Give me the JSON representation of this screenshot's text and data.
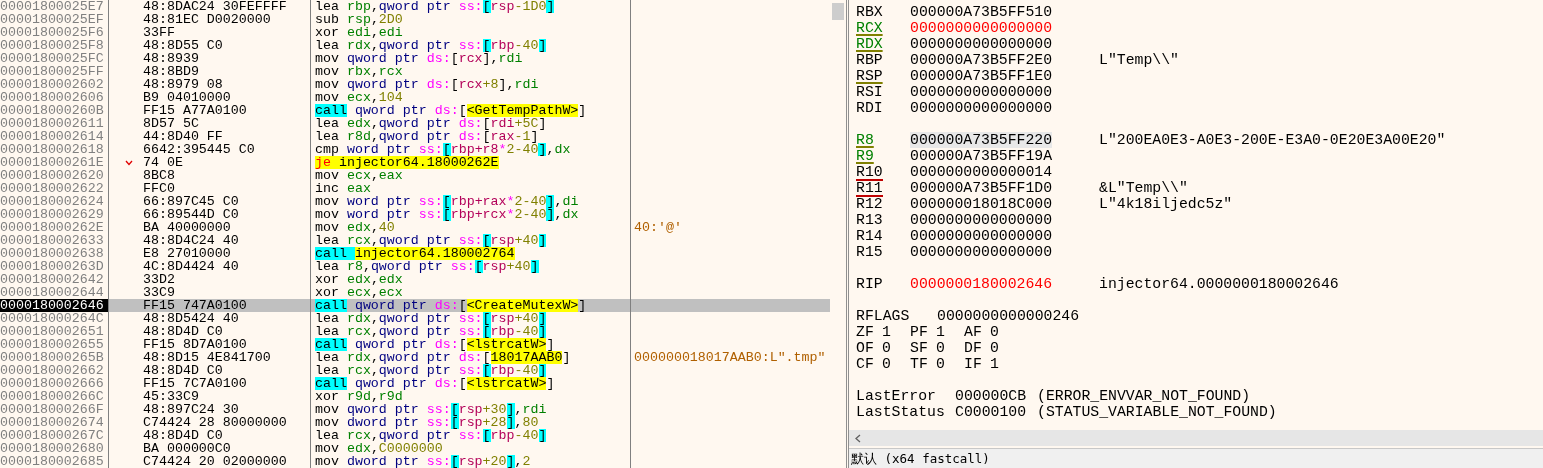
{
  "disassembly": {
    "rows": [
      {
        "address": "00001800025E7",
        "bytes": "48:8DAC24 30FEFFFF",
        "jump_arrow": false,
        "current": false,
        "tokens": [
          {
            "text": "lea ",
            "kind": "mnemonic"
          },
          {
            "text": "rbp",
            "kind": "register"
          },
          {
            "text": ",",
            "kind": "plain"
          },
          {
            "text": "qword ptr ",
            "kind": "size"
          },
          {
            "text": "ss:",
            "kind": "segment"
          },
          {
            "text": "[",
            "kind": "bracket"
          },
          {
            "text": "rsp",
            "kind": "memreg"
          },
          {
            "text": "-1D0",
            "kind": "number"
          },
          {
            "text": "]",
            "kind": "bracket"
          }
        ]
      },
      {
        "address": "00001800025EF",
        "bytes": "48:81EC D0020000",
        "jump_arrow": false,
        "current": false,
        "tokens": [
          {
            "text": "sub ",
            "kind": "mnemonic"
          },
          {
            "text": "rsp",
            "kind": "register"
          },
          {
            "text": ",",
            "kind": "plain"
          },
          {
            "text": "2D0",
            "kind": "number"
          }
        ]
      },
      {
        "address": "00001800025F6",
        "bytes": "33FF",
        "jump_arrow": false,
        "current": false,
        "tokens": [
          {
            "text": "xor ",
            "kind": "mnemonic"
          },
          {
            "text": "edi",
            "kind": "register"
          },
          {
            "text": ",",
            "kind": "plain"
          },
          {
            "text": "edi",
            "kind": "register"
          }
        ]
      },
      {
        "address": "00001800025F8",
        "bytes": "48:8D55 C0",
        "jump_arrow": false,
        "current": false,
        "tokens": [
          {
            "text": "lea ",
            "kind": "mnemonic"
          },
          {
            "text": "rdx",
            "kind": "register"
          },
          {
            "text": ",",
            "kind": "plain"
          },
          {
            "text": "qword ptr ",
            "kind": "size"
          },
          {
            "text": "ss:",
            "kind": "segment"
          },
          {
            "text": "[",
            "kind": "bracket"
          },
          {
            "text": "rbp",
            "kind": "memreg"
          },
          {
            "text": "-40",
            "kind": "number"
          },
          {
            "text": "]",
            "kind": "bracket"
          }
        ]
      },
      {
        "address": "00001800025FC",
        "bytes": "48:8939",
        "jump_arrow": false,
        "current": false,
        "tokens": [
          {
            "text": "mov ",
            "kind": "mnemonic"
          },
          {
            "text": "qword ptr ",
            "kind": "size"
          },
          {
            "text": "ds:",
            "kind": "segment"
          },
          {
            "text": "[",
            "kind": "plain"
          },
          {
            "text": "rcx",
            "kind": "memreg"
          },
          {
            "text": "],",
            "kind": "plain"
          },
          {
            "text": "rdi",
            "kind": "register"
          }
        ]
      },
      {
        "address": "00001800025FF",
        "bytes": "48:8BD9",
        "jump_arrow": false,
        "current": false,
        "tokens": [
          {
            "text": "mov ",
            "kind": "mnemonic"
          },
          {
            "text": "rbx",
            "kind": "register"
          },
          {
            "text": ",",
            "kind": "plain"
          },
          {
            "text": "rcx",
            "kind": "register"
          }
        ]
      },
      {
        "address": "0000180002602",
        "bytes": "48:8979 08",
        "jump_arrow": false,
        "current": false,
        "tokens": [
          {
            "text": "mov ",
            "kind": "mnemonic"
          },
          {
            "text": "qword ptr ",
            "kind": "size"
          },
          {
            "text": "ds:",
            "kind": "segment"
          },
          {
            "text": "[",
            "kind": "plain"
          },
          {
            "text": "rcx",
            "kind": "memreg"
          },
          {
            "text": "+8",
            "kind": "number"
          },
          {
            "text": "],",
            "kind": "plain"
          },
          {
            "text": "rdi",
            "kind": "register"
          }
        ]
      },
      {
        "address": "0000180002606",
        "bytes": "B9 04010000",
        "jump_arrow": false,
        "current": false,
        "tokens": [
          {
            "text": "mov ",
            "kind": "mnemonic"
          },
          {
            "text": "ecx",
            "kind": "register"
          },
          {
            "text": ",",
            "kind": "plain"
          },
          {
            "text": "104",
            "kind": "number"
          }
        ]
      },
      {
        "address": "000018000260B",
        "bytes": "FF15 A77A0100",
        "jump_arrow": false,
        "current": false,
        "tokens": [
          {
            "text": "call",
            "kind": "call"
          },
          {
            "text": " qword ptr ",
            "kind": "size"
          },
          {
            "text": "ds:",
            "kind": "segment"
          },
          {
            "text": "[",
            "kind": "plain"
          },
          {
            "text": "<GetTempPathW>",
            "kind": "label"
          },
          {
            "text": "]",
            "kind": "plain"
          }
        ]
      },
      {
        "address": "0000180002611",
        "bytes": "8D57 5C",
        "jump_arrow": false,
        "current": false,
        "tokens": [
          {
            "text": "lea ",
            "kind": "mnemonic"
          },
          {
            "text": "edx",
            "kind": "register"
          },
          {
            "text": ",",
            "kind": "plain"
          },
          {
            "text": "qword ptr ",
            "kind": "size"
          },
          {
            "text": "ds:",
            "kind": "segment"
          },
          {
            "text": "[",
            "kind": "plain"
          },
          {
            "text": "rdi",
            "kind": "memreg"
          },
          {
            "text": "+5C",
            "kind": "number"
          },
          {
            "text": "]",
            "kind": "plain"
          }
        ]
      },
      {
        "address": "0000180002614",
        "bytes": "44:8D40 FF",
        "jump_arrow": false,
        "current": false,
        "tokens": [
          {
            "text": "lea ",
            "kind": "mnemonic"
          },
          {
            "text": "r8d",
            "kind": "register"
          },
          {
            "text": ",",
            "kind": "plain"
          },
          {
            "text": "qword ptr ",
            "kind": "size"
          },
          {
            "text": "ds:",
            "kind": "segment"
          },
          {
            "text": "[",
            "kind": "plain"
          },
          {
            "text": "rax",
            "kind": "memreg"
          },
          {
            "text": "-1",
            "kind": "number"
          },
          {
            "text": "]",
            "kind": "plain"
          }
        ]
      },
      {
        "address": "0000180002618",
        "bytes": "6642:395445 C0",
        "jump_arrow": false,
        "current": false,
        "tokens": [
          {
            "text": "cmp ",
            "kind": "mnemonic"
          },
          {
            "text": "word ptr ",
            "kind": "size"
          },
          {
            "text": "ss:",
            "kind": "segment"
          },
          {
            "text": "[",
            "kind": "bracket"
          },
          {
            "text": "rbp+r8",
            "kind": "memreg"
          },
          {
            "text": "*",
            "kind": "segment"
          },
          {
            "text": "2-40",
            "kind": "number"
          },
          {
            "text": "]",
            "kind": "bracket"
          },
          {
            "text": ",",
            "kind": "plain"
          },
          {
            "text": "dx",
            "kind": "register"
          }
        ]
      },
      {
        "address": "000018000261E",
        "bytes": "74 0E",
        "jump_arrow": true,
        "current": false,
        "tokens": [
          {
            "text": "je ",
            "kind": "jump"
          },
          {
            "text": "injector64.18000262E",
            "kind": "label"
          }
        ]
      },
      {
        "address": "0000180002620",
        "bytes": "8BC8",
        "jump_arrow": false,
        "current": false,
        "tokens": [
          {
            "text": "mov ",
            "kind": "mnemonic"
          },
          {
            "text": "ecx",
            "kind": "register"
          },
          {
            "text": ",",
            "kind": "plain"
          },
          {
            "text": "eax",
            "kind": "register"
          }
        ]
      },
      {
        "address": "0000180002622",
        "bytes": "FFC0",
        "jump_arrow": false,
        "current": false,
        "tokens": [
          {
            "text": "inc ",
            "kind": "mnemonic"
          },
          {
            "text": "eax",
            "kind": "register"
          }
        ]
      },
      {
        "address": "0000180002624",
        "bytes": "66:897C45 C0",
        "jump_arrow": false,
        "current": false,
        "tokens": [
          {
            "text": "mov ",
            "kind": "mnemonic"
          },
          {
            "text": "word ptr ",
            "kind": "size"
          },
          {
            "text": "ss:",
            "kind": "segment"
          },
          {
            "text": "[",
            "kind": "bracket"
          },
          {
            "text": "rbp+rax",
            "kind": "memreg"
          },
          {
            "text": "*",
            "kind": "segment"
          },
          {
            "text": "2-40",
            "kind": "number"
          },
          {
            "text": "]",
            "kind": "bracket"
          },
          {
            "text": ",",
            "kind": "plain"
          },
          {
            "text": "di",
            "kind": "register"
          }
        ]
      },
      {
        "address": "0000180002629",
        "bytes": "66:89544D C0",
        "jump_arrow": false,
        "current": false,
        "tokens": [
          {
            "text": "mov ",
            "kind": "mnemonic"
          },
          {
            "text": "word ptr ",
            "kind": "size"
          },
          {
            "text": "ss:",
            "kind": "segment"
          },
          {
            "text": "[",
            "kind": "bracket"
          },
          {
            "text": "rbp+rcx",
            "kind": "memreg"
          },
          {
            "text": "*",
            "kind": "segment"
          },
          {
            "text": "2-40",
            "kind": "number"
          },
          {
            "text": "]",
            "kind": "bracket"
          },
          {
            "text": ",",
            "kind": "plain"
          },
          {
            "text": "dx",
            "kind": "register"
          }
        ]
      },
      {
        "address": "000018000262E",
        "bytes": "BA 40000000",
        "jump_arrow": false,
        "current": false,
        "comment": "40:'@'",
        "tokens": [
          {
            "text": "mov ",
            "kind": "mnemonic"
          },
          {
            "text": "edx",
            "kind": "register"
          },
          {
            "text": ",",
            "kind": "plain"
          },
          {
            "text": "40",
            "kind": "number"
          }
        ]
      },
      {
        "address": "0000180002633",
        "bytes": "48:8D4C24 40",
        "jump_arrow": false,
        "current": false,
        "tokens": [
          {
            "text": "lea ",
            "kind": "mnemonic"
          },
          {
            "text": "rcx",
            "kind": "register"
          },
          {
            "text": ",",
            "kind": "plain"
          },
          {
            "text": "qword ptr ",
            "kind": "size"
          },
          {
            "text": "ss:",
            "kind": "segment"
          },
          {
            "text": "[",
            "kind": "bracket"
          },
          {
            "text": "rsp",
            "kind": "memreg"
          },
          {
            "text": "+40",
            "kind": "number"
          },
          {
            "text": "]",
            "kind": "bracket"
          }
        ]
      },
      {
        "address": "0000180002638",
        "bytes": "E8 27010000",
        "jump_arrow": false,
        "current": false,
        "tokens": [
          {
            "text": "call ",
            "kind": "call"
          },
          {
            "text": "injector64.180002764",
            "kind": "label"
          }
        ]
      },
      {
        "address": "000018000263D",
        "bytes": "4C:8D4424 40",
        "jump_arrow": false,
        "current": false,
        "tokens": [
          {
            "text": "lea ",
            "kind": "mnemonic"
          },
          {
            "text": "r8",
            "kind": "register"
          },
          {
            "text": ",",
            "kind": "plain"
          },
          {
            "text": "qword ptr ",
            "kind": "size"
          },
          {
            "text": "ss:",
            "kind": "segment"
          },
          {
            "text": "[",
            "kind": "bracket"
          },
          {
            "text": "rsp",
            "kind": "memreg"
          },
          {
            "text": "+40",
            "kind": "number"
          },
          {
            "text": "]",
            "kind": "bracket"
          }
        ]
      },
      {
        "address": "0000180002642",
        "bytes": "33D2",
        "jump_arrow": false,
        "current": false,
        "tokens": [
          {
            "text": "xor ",
            "kind": "mnemonic"
          },
          {
            "text": "edx",
            "kind": "register"
          },
          {
            "text": ",",
            "kind": "plain"
          },
          {
            "text": "edx",
            "kind": "register"
          }
        ]
      },
      {
        "address": "0000180002644",
        "bytes": "33C9",
        "jump_arrow": false,
        "current": false,
        "tokens": [
          {
            "text": "xor ",
            "kind": "mnemonic"
          },
          {
            "text": "ecx",
            "kind": "register"
          },
          {
            "text": ",",
            "kind": "plain"
          },
          {
            "text": "ecx",
            "kind": "register"
          }
        ]
      },
      {
        "address": "0000180002646",
        "bytes": "FF15 747A0100",
        "jump_arrow": false,
        "current": true,
        "tokens": [
          {
            "text": "call",
            "kind": "call"
          },
          {
            "text": " qword ptr ",
            "kind": "size"
          },
          {
            "text": "ds:",
            "kind": "segment"
          },
          {
            "text": "[",
            "kind": "plain"
          },
          {
            "text": "<CreateMutexW>",
            "kind": "label"
          },
          {
            "text": "]",
            "kind": "plain"
          }
        ]
      },
      {
        "address": "000018000264C",
        "bytes": "48:8D5424 40",
        "jump_arrow": false,
        "current": false,
        "tokens": [
          {
            "text": "lea ",
            "kind": "mnemonic"
          },
          {
            "text": "rdx",
            "kind": "register"
          },
          {
            "text": ",",
            "kind": "plain"
          },
          {
            "text": "qword ptr ",
            "kind": "size"
          },
          {
            "text": "ss:",
            "kind": "segment"
          },
          {
            "text": "[",
            "kind": "bracket"
          },
          {
            "text": "rsp",
            "kind": "memreg"
          },
          {
            "text": "+40",
            "kind": "number"
          },
          {
            "text": "]",
            "kind": "bracket"
          }
        ]
      },
      {
        "address": "0000180002651",
        "bytes": "48:8D4D C0",
        "jump_arrow": false,
        "current": false,
        "tokens": [
          {
            "text": "lea ",
            "kind": "mnemonic"
          },
          {
            "text": "rcx",
            "kind": "register"
          },
          {
            "text": ",",
            "kind": "plain"
          },
          {
            "text": "qword ptr ",
            "kind": "size"
          },
          {
            "text": "ss:",
            "kind": "segment"
          },
          {
            "text": "[",
            "kind": "bracket"
          },
          {
            "text": "rbp",
            "kind": "memreg"
          },
          {
            "text": "-40",
            "kind": "number"
          },
          {
            "text": "]",
            "kind": "bracket"
          }
        ]
      },
      {
        "address": "0000180002655",
        "bytes": "FF15 8D7A0100",
        "jump_arrow": false,
        "current": false,
        "tokens": [
          {
            "text": "call",
            "kind": "call"
          },
          {
            "text": " qword ptr ",
            "kind": "size"
          },
          {
            "text": "ds:",
            "kind": "segment"
          },
          {
            "text": "[",
            "kind": "plain"
          },
          {
            "text": "<lstrcatW>",
            "kind": "label"
          },
          {
            "text": "]",
            "kind": "plain"
          }
        ]
      },
      {
        "address": "000018000265B",
        "bytes": "48:8D15 4E841700",
        "jump_arrow": false,
        "current": false,
        "comment": "000000018017AAB0:L\".tmp\"",
        "tokens": [
          {
            "text": "lea ",
            "kind": "mnemonic"
          },
          {
            "text": "rdx",
            "kind": "register"
          },
          {
            "text": ",",
            "kind": "plain"
          },
          {
            "text": "qword ptr ",
            "kind": "size"
          },
          {
            "text": "ds:",
            "kind": "segment"
          },
          {
            "text": "[",
            "kind": "plain"
          },
          {
            "text": "18017AAB0",
            "kind": "label"
          },
          {
            "text": "]",
            "kind": "plain"
          }
        ]
      },
      {
        "address": "0000180002662",
        "bytes": "48:8D4D C0",
        "jump_arrow": false,
        "current": false,
        "tokens": [
          {
            "text": "lea ",
            "kind": "mnemonic"
          },
          {
            "text": "rcx",
            "kind": "register"
          },
          {
            "text": ",",
            "kind": "plain"
          },
          {
            "text": "qword ptr ",
            "kind": "size"
          },
          {
            "text": "ss:",
            "kind": "segment"
          },
          {
            "text": "[",
            "kind": "bracket"
          },
          {
            "text": "rbp",
            "kind": "memreg"
          },
          {
            "text": "-40",
            "kind": "number"
          },
          {
            "text": "]",
            "kind": "bracket"
          }
        ]
      },
      {
        "address": "0000180002666",
        "bytes": "FF15 7C7A0100",
        "jump_arrow": false,
        "current": false,
        "tokens": [
          {
            "text": "call",
            "kind": "call"
          },
          {
            "text": " qword ptr ",
            "kind": "size"
          },
          {
            "text": "ds:",
            "kind": "segment"
          },
          {
            "text": "[",
            "kind": "plain"
          },
          {
            "text": "<lstrcatW>",
            "kind": "label"
          },
          {
            "text": "]",
            "kind": "plain"
          }
        ]
      },
      {
        "address": "000018000266C",
        "bytes": "45:33C9",
        "jump_arrow": false,
        "current": false,
        "tokens": [
          {
            "text": "xor ",
            "kind": "mnemonic"
          },
          {
            "text": "r9d",
            "kind": "register"
          },
          {
            "text": ",",
            "kind": "plain"
          },
          {
            "text": "r9d",
            "kind": "register"
          }
        ]
      },
      {
        "address": "000018000266F",
        "bytes": "48:897C24 30",
        "jump_arrow": false,
        "current": false,
        "tokens": [
          {
            "text": "mov ",
            "kind": "mnemonic"
          },
          {
            "text": "qword ptr ",
            "kind": "size"
          },
          {
            "text": "ss:",
            "kind": "segment"
          },
          {
            "text": "[",
            "kind": "bracket"
          },
          {
            "text": "rsp",
            "kind": "memreg"
          },
          {
            "text": "+30",
            "kind": "number"
          },
          {
            "text": "]",
            "kind": "bracket"
          },
          {
            "text": ",",
            "kind": "plain"
          },
          {
            "text": "rdi",
            "kind": "register"
          }
        ]
      },
      {
        "address": "0000180002674",
        "bytes": "C74424 28 80000000",
        "jump_arrow": false,
        "current": false,
        "tokens": [
          {
            "text": "mov ",
            "kind": "mnemonic"
          },
          {
            "text": "dword ptr ",
            "kind": "size"
          },
          {
            "text": "ss:",
            "kind": "segment"
          },
          {
            "text": "[",
            "kind": "bracket"
          },
          {
            "text": "rsp",
            "kind": "memreg"
          },
          {
            "text": "+28",
            "kind": "number"
          },
          {
            "text": "]",
            "kind": "bracket"
          },
          {
            "text": ",",
            "kind": "plain"
          },
          {
            "text": "80",
            "kind": "number"
          }
        ]
      },
      {
        "address": "000018000267C",
        "bytes": "48:8D4D C0",
        "jump_arrow": false,
        "current": false,
        "tokens": [
          {
            "text": "lea ",
            "kind": "mnemonic"
          },
          {
            "text": "rcx",
            "kind": "register"
          },
          {
            "text": ",",
            "kind": "plain"
          },
          {
            "text": "qword ptr ",
            "kind": "size"
          },
          {
            "text": "ss:",
            "kind": "segment"
          },
          {
            "text": "[",
            "kind": "bracket"
          },
          {
            "text": "rbp",
            "kind": "memreg"
          },
          {
            "text": "-40",
            "kind": "number"
          },
          {
            "text": "]",
            "kind": "bracket"
          }
        ]
      },
      {
        "address": "0000180002680",
        "bytes": "BA 000000C0",
        "jump_arrow": false,
        "current": false,
        "tokens": [
          {
            "text": "mov ",
            "kind": "mnemonic"
          },
          {
            "text": "edx",
            "kind": "register"
          },
          {
            "text": ",",
            "kind": "plain"
          },
          {
            "text": "C0000000",
            "kind": "number"
          }
        ]
      },
      {
        "address": "0000180002685",
        "bytes": "C74424 20 02000000",
        "jump_arrow": false,
        "current": false,
        "tokens": [
          {
            "text": "mov ",
            "kind": "mnemonic"
          },
          {
            "text": "dword ptr ",
            "kind": "size"
          },
          {
            "text": "ss:",
            "kind": "segment"
          },
          {
            "text": "[",
            "kind": "bracket"
          },
          {
            "text": "rsp",
            "kind": "memreg"
          },
          {
            "text": "+20",
            "kind": "number"
          },
          {
            "text": "]",
            "kind": "bracket"
          },
          {
            "text": ",",
            "kind": "plain"
          },
          {
            "text": "2",
            "kind": "number"
          }
        ]
      }
    ]
  },
  "register_groups": [
    {
      "registers": [
        {
          "name": "RBX",
          "value": "000000A73B5FF510",
          "olive_underline": false,
          "red_underline": false,
          "highlight_name": false,
          "value_changed": false,
          "selected": false
        },
        {
          "name": "RCX",
          "value": "0000000000000000",
          "olive_underline": true,
          "red_underline": false,
          "highlight_name": true,
          "value_changed": true,
          "selected": false
        },
        {
          "name": "RDX",
          "value": "0000000000000000",
          "olive_underline": true,
          "red_underline": false,
          "highlight_name": true,
          "value_changed": false,
          "selected": false
        },
        {
          "name": "RBP",
          "value": "000000A73B5FF2E0",
          "comment": "L\"Temp\\\\\"",
          "olive_underline": false,
          "red_underline": false,
          "highlight_name": false,
          "value_changed": false,
          "selected": false
        },
        {
          "name": "RSP",
          "value": "000000A73B5FF1E0",
          "olive_underline": true,
          "red_underline": false,
          "highlight_name": false,
          "value_changed": false,
          "selected": false
        },
        {
          "name": "RSI",
          "value": "0000000000000000",
          "olive_underline": false,
          "red_underline": false,
          "highlight_name": false,
          "value_changed": false,
          "selected": false
        },
        {
          "name": "RDI",
          "value": "0000000000000000",
          "olive_underline": false,
          "red_underline": false,
          "highlight_name": false,
          "value_changed": false,
          "selected": false
        }
      ]
    },
    {
      "registers": [
        {
          "name": "R8",
          "value": "000000A73B5FF220",
          "comment": "L\"200EA0E3-A0E3-200E-E3A0-0E20E3A00E20\"",
          "olive_underline": true,
          "red_underline": false,
          "highlight_name": true,
          "value_changed": false,
          "selected": true
        },
        {
          "name": "R9",
          "value": "000000A73B5FF19A",
          "olive_underline": true,
          "red_underline": false,
          "highlight_name": true,
          "value_changed": false,
          "selected": false
        },
        {
          "name": "R10",
          "value": "0000000000000014",
          "olive_underline": false,
          "red_underline": true,
          "highlight_name": false,
          "value_changed": false,
          "selected": false
        },
        {
          "name": "R11",
          "value": "000000A73B5FF1D0",
          "comment": "&L\"Temp\\\\\"",
          "olive_underline": false,
          "red_underline": true,
          "highlight_name": false,
          "value_changed": false,
          "selected": false
        },
        {
          "name": "R12",
          "value": "000000018018C000",
          "comment": "L\"4k18iljedc5z\"",
          "olive_underline": false,
          "red_underline": false,
          "highlight_name": false,
          "value_changed": false,
          "selected": false
        },
        {
          "name": "R13",
          "value": "0000000000000000",
          "olive_underline": false,
          "red_underline": false,
          "highlight_name": false,
          "value_changed": false,
          "selected": false
        },
        {
          "name": "R14",
          "value": "0000000000000000",
          "olive_underline": false,
          "red_underline": false,
          "highlight_name": false,
          "value_changed": false,
          "selected": false
        },
        {
          "name": "R15",
          "value": "0000000000000000",
          "olive_underline": false,
          "red_underline": false,
          "highlight_name": false,
          "value_changed": false,
          "selected": false
        }
      ]
    },
    {
      "registers": [
        {
          "name": "RIP",
          "value": "0000000180002646",
          "comment": "injector64.0000000180002646",
          "olive_underline": false,
          "red_underline": false,
          "highlight_name": false,
          "value_changed": true,
          "selected": false
        }
      ]
    }
  ],
  "rflags": {
    "label": "RFLAGS",
    "value": "0000000000000246"
  },
  "flags": [
    {
      "name": "ZF",
      "value": "1"
    },
    {
      "name": "PF",
      "value": "1"
    },
    {
      "name": "AF",
      "value": "0"
    },
    {
      "name": "OF",
      "value": "0"
    },
    {
      "name": "SF",
      "value": "0"
    },
    {
      "name": "DF",
      "value": "0"
    },
    {
      "name": "CF",
      "value": "0"
    },
    {
      "name": "TF",
      "value": "0"
    },
    {
      "name": "IF",
      "value": "1"
    }
  ],
  "last_values": [
    {
      "label": "LastError",
      "code": "000000CB",
      "meaning": "(ERROR_ENVVAR_NOT_FOUND)"
    },
    {
      "label": "LastStatus",
      "code": "C0000100",
      "meaning": "(STATUS_VARIABLE_NOT_FOUND)"
    }
  ],
  "status_bar": {
    "text": "默认 (x64 fastcall)"
  }
}
